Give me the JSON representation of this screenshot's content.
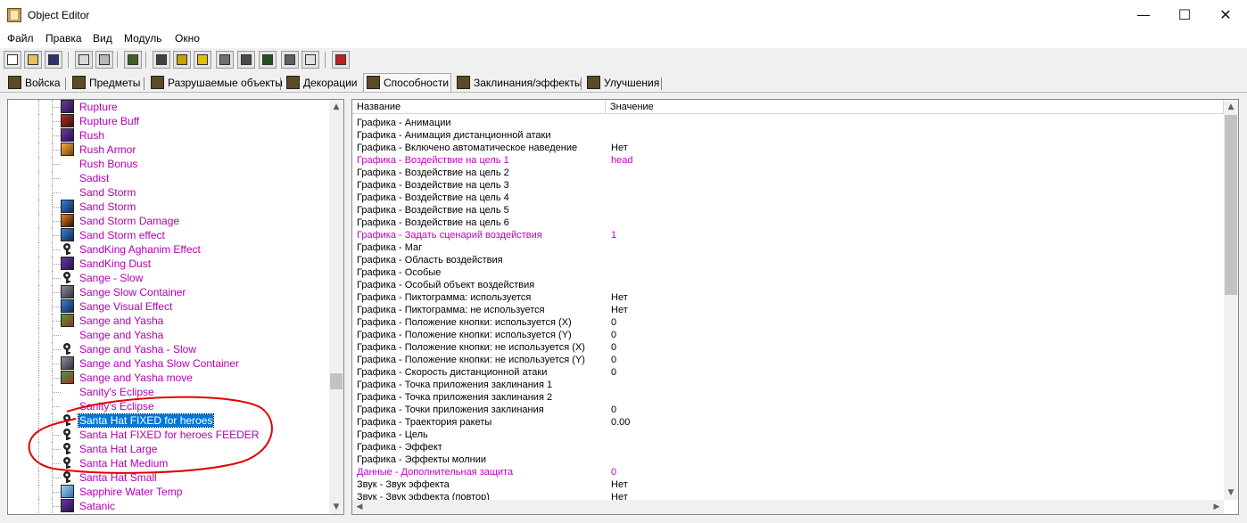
{
  "window": {
    "title": "Object Editor",
    "minimize": "—",
    "maximize": "☐",
    "close": "✕"
  },
  "menu": [
    "Файл",
    "Правка",
    "Вид",
    "Модуль",
    "Окно"
  ],
  "tabs": [
    "Войска",
    "Предметы",
    "Разрушаемые объекты",
    "Декорации",
    "Способности",
    "Заклинания/эффекты",
    "Улучшения"
  ],
  "active_tab": "Способности",
  "toolbar": {
    "buttons": [
      "new-icon",
      "open-icon",
      "save-icon",
      "copy-icon",
      "paste-icon",
      "unit-palette-icon",
      "terrain-icon",
      "text-icon",
      "sound-icon",
      "object-editor-icon",
      "campaign-icon",
      "ai-icon",
      "import-icon",
      "object-manager-icon",
      "test-map-icon"
    ]
  },
  "tree": {
    "items": [
      {
        "label": "Rupture",
        "icon": "purple"
      },
      {
        "label": "Rupture Buff",
        "icon": "red"
      },
      {
        "label": "Rush",
        "icon": "purple"
      },
      {
        "label": "Rush Armor",
        "icon": "gold"
      },
      {
        "label": "Rush Bonus",
        "icon": "none"
      },
      {
        "label": "Sadist",
        "icon": "none"
      },
      {
        "label": "Sand Storm",
        "icon": "none"
      },
      {
        "label": "Sand Storm",
        "icon": "blue"
      },
      {
        "label": "Sand Storm Damage",
        "icon": "fire"
      },
      {
        "label": "Sand Storm effect",
        "icon": "blue"
      },
      {
        "label": "SandKing Aghanim Effect",
        "icon": "key"
      },
      {
        "label": "SandKing Dust",
        "icon": "purple"
      },
      {
        "label": "Sange - Slow",
        "icon": "key"
      },
      {
        "label": "Sange Slow Container",
        "icon": "grey"
      },
      {
        "label": "Sange Visual Effect",
        "icon": "blue"
      },
      {
        "label": "Sange and Yasha",
        "icon": "green"
      },
      {
        "label": "Sange and Yasha",
        "icon": "none"
      },
      {
        "label": "Sange and Yasha - Slow",
        "icon": "key"
      },
      {
        "label": "Sange and Yasha Slow Container",
        "icon": "grey"
      },
      {
        "label": "Sange and Yasha move",
        "icon": "green"
      },
      {
        "label": "Sanity's Eclipse",
        "icon": "none"
      },
      {
        "label": "Sanity's Eclipse",
        "icon": "none"
      },
      {
        "label": "Santa Hat FIXED for heroes",
        "icon": "key",
        "selected": true
      },
      {
        "label": "Santa Hat FIXED for heroes FEEDER",
        "icon": "key"
      },
      {
        "label": "Santa Hat Large",
        "icon": "key"
      },
      {
        "label": "Santa Hat Medium",
        "icon": "key"
      },
      {
        "label": "Santa Hat Small",
        "icon": "key"
      },
      {
        "label": "Sapphire Water Temp",
        "icon": "lightblue"
      },
      {
        "label": "Satanic",
        "icon": "purple"
      }
    ]
  },
  "grid": {
    "col_name": "Название",
    "col_value": "Значение",
    "rows": [
      {
        "name": "Графика - Анимации",
        "value": ""
      },
      {
        "name": "Графика - Анимация дистанционной атаки",
        "value": ""
      },
      {
        "name": "Графика - Включено автоматическое наведение",
        "value": "Нет"
      },
      {
        "name": "Графика - Воздействие на цель 1",
        "value": "head",
        "modified": true
      },
      {
        "name": "Графика - Воздействие на цель 2",
        "value": ""
      },
      {
        "name": "Графика - Воздействие на цель 3",
        "value": ""
      },
      {
        "name": "Графика - Воздействие на цель 4",
        "value": ""
      },
      {
        "name": "Графика - Воздействие на цель 5",
        "value": ""
      },
      {
        "name": "Графика - Воздействие на цель 6",
        "value": ""
      },
      {
        "name": "Графика - Задать сценарий воздействия",
        "value": "1",
        "modified": true
      },
      {
        "name": "Графика - Маг",
        "value": ""
      },
      {
        "name": "Графика - Область воздействия",
        "value": ""
      },
      {
        "name": "Графика - Особые",
        "value": ""
      },
      {
        "name": "Графика - Особый объект воздействия",
        "value": ""
      },
      {
        "name": "Графика - Пиктограмма: используется",
        "value": "Нет"
      },
      {
        "name": "Графика - Пиктограмма: не используется",
        "value": "Нет"
      },
      {
        "name": "Графика - Положение кнопки: используется (X)",
        "value": "0"
      },
      {
        "name": "Графика - Положение кнопки: используется (Y)",
        "value": "0"
      },
      {
        "name": "Графика - Положение кнопки: не используется (X)",
        "value": "0"
      },
      {
        "name": "Графика - Положение кнопки: не используется (Y)",
        "value": "0"
      },
      {
        "name": "Графика - Скорость дистанционной атаки",
        "value": "0"
      },
      {
        "name": "Графика - Точка приложения заклинания 1",
        "value": ""
      },
      {
        "name": "Графика - Точка приложения заклинания 2",
        "value": ""
      },
      {
        "name": "Графика - Точки приложения заклинания",
        "value": "0"
      },
      {
        "name": "Графика - Траектория ракеты",
        "value": "0.00"
      },
      {
        "name": "Графика - Цель",
        "value": ""
      },
      {
        "name": "Графика - Эффект",
        "value": ""
      },
      {
        "name": "Графика - Эффекты молнии",
        "value": ""
      },
      {
        "name": "Данные - Дополнительная защита",
        "value": "0",
        "modified": true
      },
      {
        "name": "Звук - Звук эффекта",
        "value": "Нет"
      },
      {
        "name": "Звук - Звук эффекта (повтор)",
        "value": "Нет"
      }
    ]
  },
  "colors": {
    "modified": "#c000c0",
    "selection": "#0078d7",
    "annotation": "#e00000"
  }
}
